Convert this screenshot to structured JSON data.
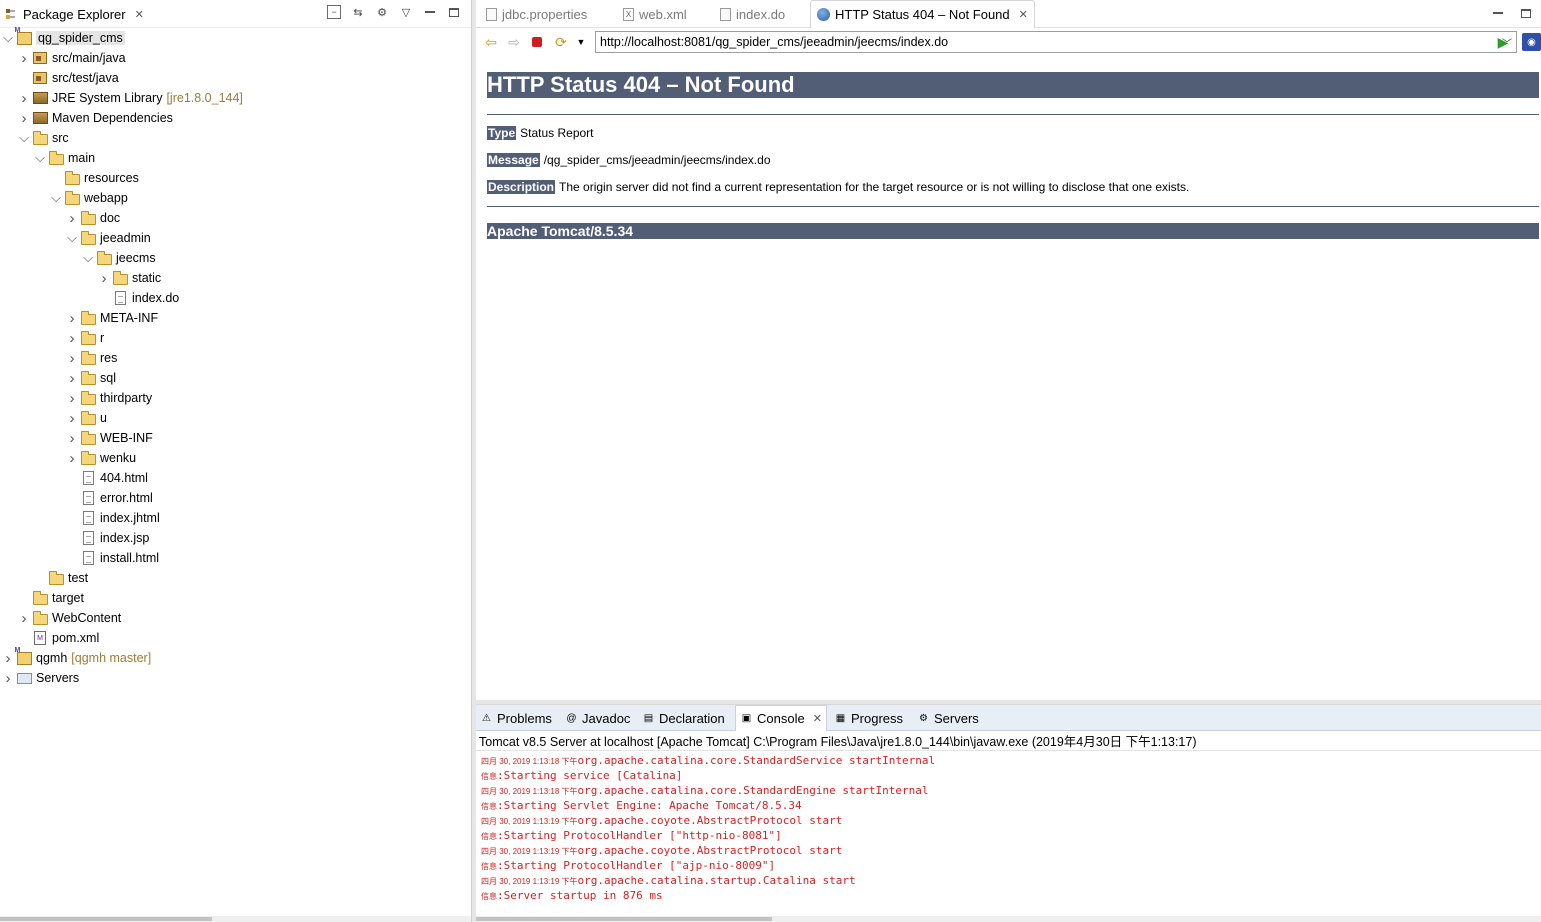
{
  "package_explorer": {
    "title": "Package Explorer",
    "tree": [
      {
        "label": "qg_spider_cms",
        "decoration": "",
        "depth": 0,
        "twisty": "open",
        "icon": "maven-project-icon",
        "selected": true
      },
      {
        "label": "src/main/java",
        "decoration": "",
        "depth": 1,
        "twisty": "closed",
        "icon": "package-folder-icon"
      },
      {
        "label": "src/test/java",
        "decoration": "",
        "depth": 1,
        "twisty": "none",
        "icon": "package-folder-icon"
      },
      {
        "label": "JRE System Library",
        "decoration": "[jre1.8.0_144]",
        "depth": 1,
        "twisty": "closed",
        "icon": "library-icon"
      },
      {
        "label": "Maven Dependencies",
        "decoration": "",
        "depth": 1,
        "twisty": "closed",
        "icon": "library-icon"
      },
      {
        "label": "src",
        "decoration": "",
        "depth": 1,
        "twisty": "open",
        "icon": "folder-icon"
      },
      {
        "label": "main",
        "decoration": "",
        "depth": 2,
        "twisty": "open",
        "icon": "folder-icon"
      },
      {
        "label": "resources",
        "decoration": "",
        "depth": 3,
        "twisty": "none",
        "icon": "folder-icon"
      },
      {
        "label": "webapp",
        "decoration": "",
        "depth": 3,
        "twisty": "open",
        "icon": "folder-icon"
      },
      {
        "label": "doc",
        "decoration": "",
        "depth": 4,
        "twisty": "closed",
        "icon": "folder-icon"
      },
      {
        "label": "jeeadmin",
        "decoration": "",
        "depth": 4,
        "twisty": "open",
        "icon": "folder-icon"
      },
      {
        "label": "jeecms",
        "decoration": "",
        "depth": 5,
        "twisty": "open",
        "icon": "folder-icon"
      },
      {
        "label": "static",
        "decoration": "",
        "depth": 6,
        "twisty": "closed",
        "icon": "folder-icon"
      },
      {
        "label": "index.do",
        "decoration": "",
        "depth": 6,
        "twisty": "none",
        "icon": "file-icon"
      },
      {
        "label": "META-INF",
        "decoration": "",
        "depth": 4,
        "twisty": "closed",
        "icon": "folder-icon"
      },
      {
        "label": "r",
        "decoration": "",
        "depth": 4,
        "twisty": "closed",
        "icon": "folder-icon"
      },
      {
        "label": "res",
        "decoration": "",
        "depth": 4,
        "twisty": "closed",
        "icon": "folder-icon"
      },
      {
        "label": "sql",
        "decoration": "",
        "depth": 4,
        "twisty": "closed",
        "icon": "folder-icon"
      },
      {
        "label": "thirdparty",
        "decoration": "",
        "depth": 4,
        "twisty": "closed",
        "icon": "folder-icon"
      },
      {
        "label": "u",
        "decoration": "",
        "depth": 4,
        "twisty": "closed",
        "icon": "folder-icon"
      },
      {
        "label": "WEB-INF",
        "decoration": "",
        "depth": 4,
        "twisty": "closed",
        "icon": "folder-icon"
      },
      {
        "label": "wenku",
        "decoration": "",
        "depth": 4,
        "twisty": "closed",
        "icon": "folder-icon"
      },
      {
        "label": "404.html",
        "decoration": "",
        "depth": 4,
        "twisty": "none",
        "icon": "file-icon"
      },
      {
        "label": "error.html",
        "decoration": "",
        "depth": 4,
        "twisty": "none",
        "icon": "file-icon"
      },
      {
        "label": "index.jhtml",
        "decoration": "",
        "depth": 4,
        "twisty": "none",
        "icon": "file-icon"
      },
      {
        "label": "index.jsp",
        "decoration": "",
        "depth": 4,
        "twisty": "none",
        "icon": "file-icon"
      },
      {
        "label": "install.html",
        "decoration": "",
        "depth": 4,
        "twisty": "none",
        "icon": "file-icon"
      },
      {
        "label": "test",
        "decoration": "",
        "depth": 2,
        "twisty": "none",
        "icon": "folder-icon"
      },
      {
        "label": "target",
        "decoration": "",
        "depth": 1,
        "twisty": "none",
        "icon": "folder-icon"
      },
      {
        "label": "WebContent",
        "decoration": "",
        "depth": 1,
        "twisty": "closed",
        "icon": "folder-icon"
      },
      {
        "label": "pom.xml",
        "decoration": "",
        "depth": 1,
        "twisty": "none",
        "icon": "xml-file-icon"
      },
      {
        "label": "qgmh",
        "decoration": "[qgmh master]",
        "depth": 0,
        "twisty": "closed",
        "icon": "maven-project-icon"
      },
      {
        "label": "Servers",
        "decoration": "",
        "depth": 0,
        "twisty": "closed",
        "icon": "servers-folder-icon"
      }
    ]
  },
  "editor": {
    "tabs": [
      {
        "label": "jdbc.properties",
        "active": false,
        "icon": "document-icon"
      },
      {
        "label": "web.xml",
        "active": false,
        "icon": "xml-file-icon"
      },
      {
        "label": "index.do",
        "active": false,
        "icon": "document-icon"
      },
      {
        "label": "HTTP Status 404 – Not Found",
        "active": true,
        "icon": "globe-icon"
      }
    ],
    "url": "http://localhost:8081/qg_spider_cms/jeeadmin/jeecms/index.do"
  },
  "page": {
    "heading": "HTTP Status 404 – Not Found",
    "type_label": "Type",
    "type_value": "Status Report",
    "message_label": "Message",
    "message_value": "/qg_spider_cms/jeeadmin/jeecms/index.do",
    "description_label": "Description",
    "description_value": "The origin server did not find a current representation for the target resource or is not willing to disclose that one exists.",
    "footer": "Apache Tomcat/8.5.34"
  },
  "bottom": {
    "tabs": [
      {
        "label": "Problems",
        "active": false,
        "icon": "problems-icon"
      },
      {
        "label": "Javadoc",
        "active": false,
        "icon": "javadoc-icon"
      },
      {
        "label": "Declaration",
        "active": false,
        "icon": "declaration-icon"
      },
      {
        "label": "Console",
        "active": true,
        "icon": "console-icon"
      },
      {
        "label": "Progress",
        "active": false,
        "icon": "progress-icon"
      },
      {
        "label": "Servers",
        "active": false,
        "icon": "servers-icon"
      }
    ],
    "console_header": "Tomcat v8.5 Server at localhost [Apache Tomcat] C:\\Program Files\\Java\\jre1.8.0_144\\bin\\javaw.exe (2019年4月30日 下午1:13:17)",
    "console_lines": [
      {
        "ts": "四月 30, 2019 1:13:18 下午",
        "text": "org.apache.catalina.core.StandardService startInternal"
      },
      {
        "ts": "信息",
        "text": ":Starting service [Catalina]"
      },
      {
        "ts": "四月 30, 2019 1:13:18 下午",
        "text": "org.apache.catalina.core.StandardEngine startInternal"
      },
      {
        "ts": "信息",
        "text": ":Starting Servlet Engine: Apache Tomcat/8.5.34"
      },
      {
        "ts": "四月 30, 2019 1:13:19 下午",
        "text": "org.apache.coyote.AbstractProtocol start"
      },
      {
        "ts": "信息",
        "text": ":Starting ProtocolHandler [\"http-nio-8081\"]"
      },
      {
        "ts": "四月 30, 2019 1:13:19 下午",
        "text": "org.apache.coyote.AbstractProtocol start"
      },
      {
        "ts": "信息",
        "text": ":Starting ProtocolHandler [\"ajp-nio-8009\"]"
      },
      {
        "ts": "四月 30, 2019 1:13:19 下午",
        "text": "org.apache.catalina.startup.Catalina start"
      },
      {
        "ts": "信息",
        "text": ":Server startup in 876 ms"
      }
    ]
  }
}
